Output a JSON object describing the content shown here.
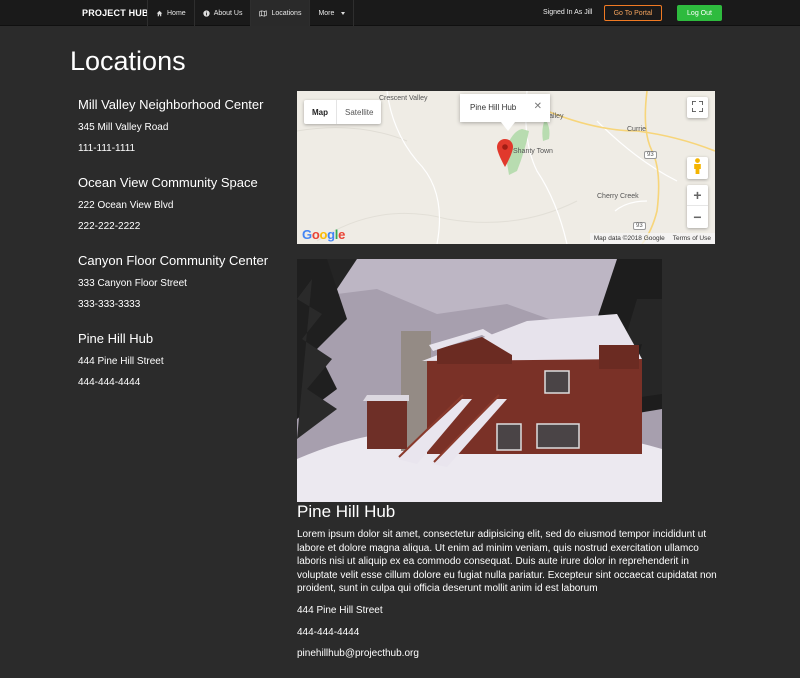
{
  "nav": {
    "brand": "PROJECT HUB",
    "links": [
      {
        "label": "Home",
        "icon": "home-icon"
      },
      {
        "label": "About Us",
        "icon": "info-icon"
      },
      {
        "label": "Locations",
        "icon": "map-icon"
      },
      {
        "label": "More",
        "icon": "caret-down-icon"
      }
    ],
    "signed_in": "Signed In As Jill",
    "portal_button": "Go To Portal",
    "logout_button": "Log Out",
    "colors": {
      "portal": "#f07a23",
      "logout": "#2ebb3e"
    }
  },
  "page": {
    "title": "Locations"
  },
  "locations": [
    {
      "name": "Mill Valley Neighborhood Center",
      "address": "345 Mill Valley Road",
      "phone": "111-111-1111"
    },
    {
      "name": "Ocean View Community Space",
      "address": "222 Ocean View Blvd",
      "phone": "222-222-2222"
    },
    {
      "name": "Canyon Floor Community Center",
      "address": "333 Canyon Floor Street",
      "phone": "333-333-3333"
    },
    {
      "name": "Pine Hill Hub",
      "address": "444 Pine Hill Street",
      "phone": "444-444-4444"
    }
  ],
  "map": {
    "type_buttons": [
      "Map",
      "Satellite"
    ],
    "info_window": "Pine Hill Hub",
    "close_glyph": "✕",
    "place_labels": [
      "Crescent Valley",
      "Valley",
      "Currie",
      "Shanty Town",
      "Cherry Creek",
      "93",
      "93"
    ],
    "zoom_in": "+",
    "zoom_out": "−",
    "logo": "Google",
    "attribution": "Map data ©2018 Google",
    "terms": "Terms of Use"
  },
  "detail": {
    "title": "Pine Hill Hub",
    "description": "Lorem ipsum dolor sit amet, consectetur adipisicing elit, sed do eiusmod tempor incididunt ut labore et dolore magna aliqua. Ut enim ad minim veniam, quis nostrud exercitation ullamco laboris nisi ut aliquip ex ea commodo consequat. Duis aute irure dolor in reprehenderit in voluptate velit esse cillum dolore eu fugiat nulla pariatur. Excepteur sint occaecat cupidatat non proident, sunt in culpa qui officia deserunt mollit anim id est laborum",
    "address": "444 Pine Hill Street",
    "phone": "444-444-4444",
    "email": "pinehillhub@projecthub.org"
  }
}
